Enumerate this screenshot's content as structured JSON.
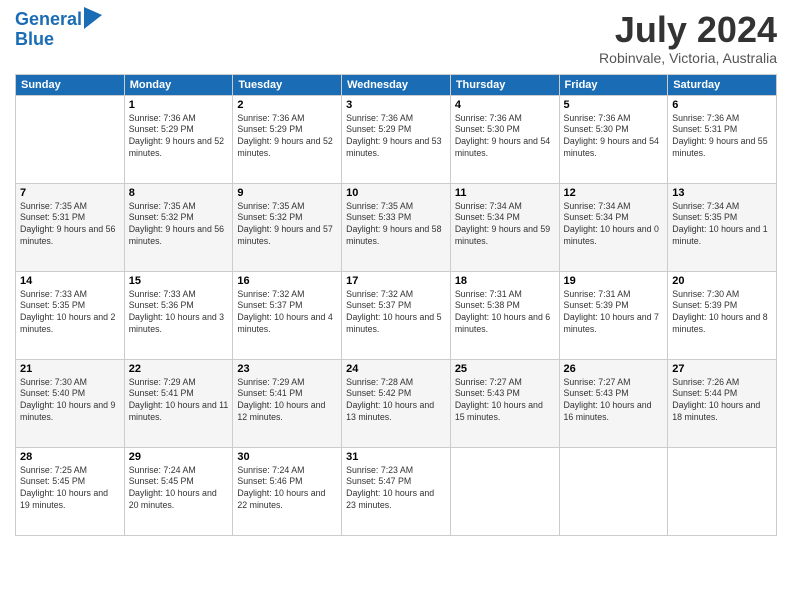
{
  "header": {
    "logo_line1": "General",
    "logo_line2": "Blue",
    "month": "July 2024",
    "location": "Robinvale, Victoria, Australia"
  },
  "columns": [
    "Sunday",
    "Monday",
    "Tuesday",
    "Wednesday",
    "Thursday",
    "Friday",
    "Saturday"
  ],
  "weeks": [
    [
      {
        "day": "",
        "empty": true
      },
      {
        "day": "1",
        "sunrise": "7:36 AM",
        "sunset": "5:29 PM",
        "daylight": "9 hours and 52 minutes."
      },
      {
        "day": "2",
        "sunrise": "7:36 AM",
        "sunset": "5:29 PM",
        "daylight": "9 hours and 52 minutes."
      },
      {
        "day": "3",
        "sunrise": "7:36 AM",
        "sunset": "5:29 PM",
        "daylight": "9 hours and 53 minutes."
      },
      {
        "day": "4",
        "sunrise": "7:36 AM",
        "sunset": "5:30 PM",
        "daylight": "9 hours and 54 minutes."
      },
      {
        "day": "5",
        "sunrise": "7:36 AM",
        "sunset": "5:30 PM",
        "daylight": "9 hours and 54 minutes."
      },
      {
        "day": "6",
        "sunrise": "7:36 AM",
        "sunset": "5:31 PM",
        "daylight": "9 hours and 55 minutes."
      }
    ],
    [
      {
        "day": "7",
        "sunrise": "7:35 AM",
        "sunset": "5:31 PM",
        "daylight": "9 hours and 56 minutes."
      },
      {
        "day": "8",
        "sunrise": "7:35 AM",
        "sunset": "5:32 PM",
        "daylight": "9 hours and 56 minutes."
      },
      {
        "day": "9",
        "sunrise": "7:35 AM",
        "sunset": "5:32 PM",
        "daylight": "9 hours and 57 minutes."
      },
      {
        "day": "10",
        "sunrise": "7:35 AM",
        "sunset": "5:33 PM",
        "daylight": "9 hours and 58 minutes."
      },
      {
        "day": "11",
        "sunrise": "7:34 AM",
        "sunset": "5:34 PM",
        "daylight": "9 hours and 59 minutes."
      },
      {
        "day": "12",
        "sunrise": "7:34 AM",
        "sunset": "5:34 PM",
        "daylight": "10 hours and 0 minutes."
      },
      {
        "day": "13",
        "sunrise": "7:34 AM",
        "sunset": "5:35 PM",
        "daylight": "10 hours and 1 minute."
      }
    ],
    [
      {
        "day": "14",
        "sunrise": "7:33 AM",
        "sunset": "5:35 PM",
        "daylight": "10 hours and 2 minutes."
      },
      {
        "day": "15",
        "sunrise": "7:33 AM",
        "sunset": "5:36 PM",
        "daylight": "10 hours and 3 minutes."
      },
      {
        "day": "16",
        "sunrise": "7:32 AM",
        "sunset": "5:37 PM",
        "daylight": "10 hours and 4 minutes."
      },
      {
        "day": "17",
        "sunrise": "7:32 AM",
        "sunset": "5:37 PM",
        "daylight": "10 hours and 5 minutes."
      },
      {
        "day": "18",
        "sunrise": "7:31 AM",
        "sunset": "5:38 PM",
        "daylight": "10 hours and 6 minutes."
      },
      {
        "day": "19",
        "sunrise": "7:31 AM",
        "sunset": "5:39 PM",
        "daylight": "10 hours and 7 minutes."
      },
      {
        "day": "20",
        "sunrise": "7:30 AM",
        "sunset": "5:39 PM",
        "daylight": "10 hours and 8 minutes."
      }
    ],
    [
      {
        "day": "21",
        "sunrise": "7:30 AM",
        "sunset": "5:40 PM",
        "daylight": "10 hours and 9 minutes."
      },
      {
        "day": "22",
        "sunrise": "7:29 AM",
        "sunset": "5:41 PM",
        "daylight": "10 hours and 11 minutes."
      },
      {
        "day": "23",
        "sunrise": "7:29 AM",
        "sunset": "5:41 PM",
        "daylight": "10 hours and 12 minutes."
      },
      {
        "day": "24",
        "sunrise": "7:28 AM",
        "sunset": "5:42 PM",
        "daylight": "10 hours and 13 minutes."
      },
      {
        "day": "25",
        "sunrise": "7:27 AM",
        "sunset": "5:43 PM",
        "daylight": "10 hours and 15 minutes."
      },
      {
        "day": "26",
        "sunrise": "7:27 AM",
        "sunset": "5:43 PM",
        "daylight": "10 hours and 16 minutes."
      },
      {
        "day": "27",
        "sunrise": "7:26 AM",
        "sunset": "5:44 PM",
        "daylight": "10 hours and 18 minutes."
      }
    ],
    [
      {
        "day": "28",
        "sunrise": "7:25 AM",
        "sunset": "5:45 PM",
        "daylight": "10 hours and 19 minutes."
      },
      {
        "day": "29",
        "sunrise": "7:24 AM",
        "sunset": "5:45 PM",
        "daylight": "10 hours and 20 minutes."
      },
      {
        "day": "30",
        "sunrise": "7:24 AM",
        "sunset": "5:46 PM",
        "daylight": "10 hours and 22 minutes."
      },
      {
        "day": "31",
        "sunrise": "7:23 AM",
        "sunset": "5:47 PM",
        "daylight": "10 hours and 23 minutes."
      },
      {
        "day": "",
        "empty": true
      },
      {
        "day": "",
        "empty": true
      },
      {
        "day": "",
        "empty": true
      }
    ]
  ]
}
